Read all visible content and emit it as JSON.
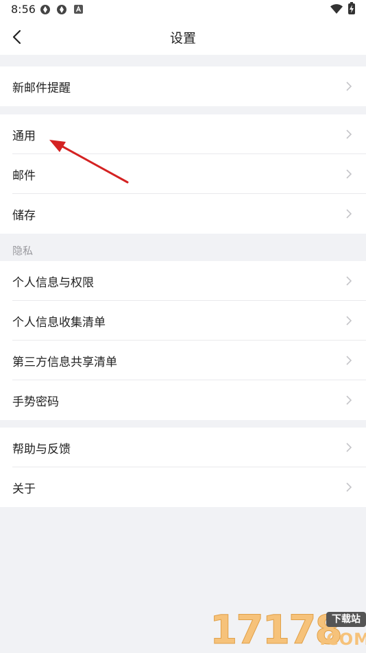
{
  "status_bar": {
    "time": "8:56"
  },
  "header": {
    "title": "设置"
  },
  "groups": {
    "mail_alert": [
      "新邮件提醒"
    ],
    "general": [
      "通用",
      "邮件",
      "储存"
    ],
    "privacy_header": "隐私",
    "privacy": [
      "个人信息与权限",
      "个人信息收集清单",
      "第三方信息共享清单",
      "手势密码"
    ],
    "about": [
      "帮助与反馈",
      "关于"
    ]
  },
  "watermark": {
    "digits": "17178",
    "tag": "下载站",
    "suffix": ".COM"
  },
  "colors": {
    "background": "#f1f2f5",
    "row": "#ffffff",
    "arrow": "#d42222",
    "section_header": "#9a9a9f"
  }
}
